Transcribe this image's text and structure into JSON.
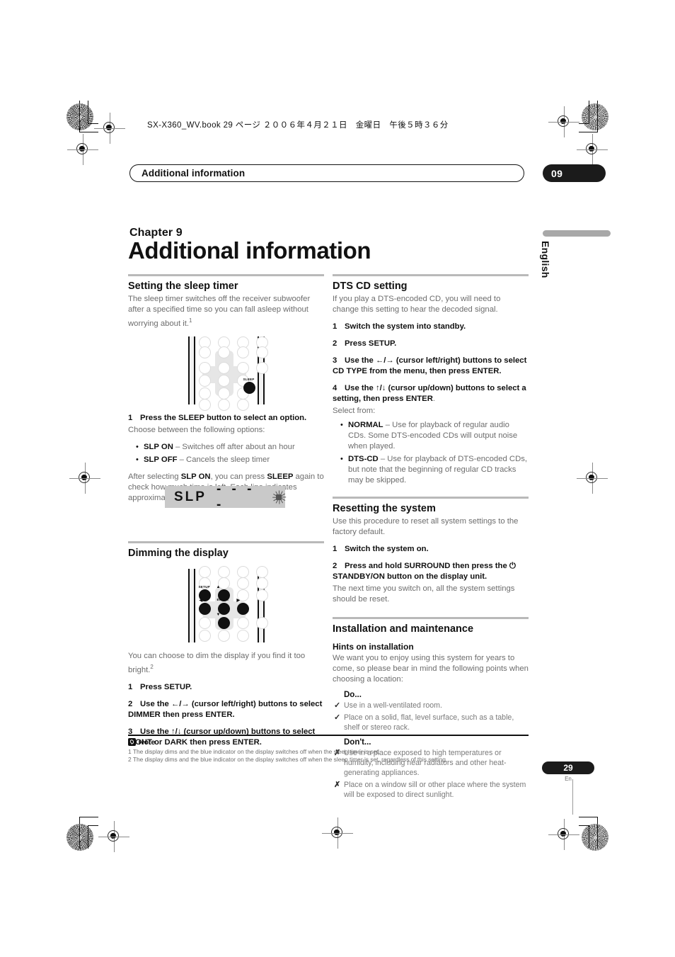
{
  "print_marks": {
    "book_header": "SX-X360_WV.book 29 ページ ２００６年４月２１日　金曜日　午後５時３６分"
  },
  "header": {
    "running_head": "Additional information",
    "chapter_badge": "09",
    "side_tab_label": "English"
  },
  "chapter": {
    "number_label": "Chapter 9",
    "title": "Additional information"
  },
  "left_column": {
    "sleep_timer": {
      "heading": "Setting the sleep timer",
      "intro": "The sleep timer switches off the receiver subwoofer after a specified time so you can fall asleep without worrying about it.",
      "intro_footnote": "1",
      "remote_sleep_label": "SLEEP",
      "step1": "Press the SLEEP button to select an option.",
      "step1_num": "1",
      "choose_line": "Choose between the following options:",
      "options": [
        {
          "term": "SLP ON",
          "desc": " – Switches off after about an hour"
        },
        {
          "term": "SLP OFF",
          "desc": " – Cancels the sleep timer"
        }
      ],
      "after_text_a": "After selecting ",
      "after_term_a": "SLP ON",
      "after_text_b": ", you can press ",
      "after_term_b": "SLEEP",
      "after_text_c": " again to check how much time is left. Each line indicates approximately 12 minutes (remaining):",
      "display_text": "SLP",
      "display_dashes": "- - - -",
      "display_icon": "sun-blink-icon"
    },
    "dimming": {
      "heading": "Dimming the display",
      "remote_setup_label": "SETUP",
      "remote_enter_label": "ENTER",
      "intro": "You can choose to dim the display if you find it too bright.",
      "intro_footnote": "2",
      "steps": [
        {
          "num": "1",
          "text": "Press SETUP."
        },
        {
          "num": "2",
          "text": "Use the ←/→ (cursor left/right) buttons to select DIMMER then press ENTER."
        },
        {
          "num": "3",
          "text": "Use the ↑/↓ (cursor up/down) buttons to select LIGHT or DARK then press ENTER."
        }
      ]
    }
  },
  "right_column": {
    "dts_cd": {
      "heading": "DTS CD setting",
      "intro": "If you play a DTS-encoded CD, you will need to change this setting to hear the decoded signal.",
      "steps": [
        {
          "num": "1",
          "text": "Switch the system into standby."
        },
        {
          "num": "2",
          "text": "Press SETUP."
        },
        {
          "num": "3",
          "text": "Use the ←/→ (cursor left/right) buttons to select CD TYPE from the menu, then press ENTER."
        },
        {
          "num": "4",
          "text": "Use the ↑/↓ (cursor up/down) buttons to select a setting, then press ENTER"
        }
      ],
      "select_from": "Select from:",
      "options": [
        {
          "term": "NORMAL",
          "desc": " – Use for playback of regular audio CDs. Some DTS-encoded CDs will output noise when played."
        },
        {
          "term": "DTS-CD",
          "desc": " – Use for playback of DTS-encoded CDs, but note that the beginning of regular CD tracks may be skipped."
        }
      ]
    },
    "resetting": {
      "heading": "Resetting the system",
      "intro": "Use this procedure to reset all system settings to the factory default.",
      "step1_num": "1",
      "step1": "Switch the system on.",
      "step2_num": "2",
      "step2": "Press and hold SURROUND then press the ⏻ STANDBY/ON button on the display unit.",
      "outro": "The next time you switch on, all the system settings should be reset."
    },
    "installation": {
      "heading": "Installation and maintenance",
      "subheading": "Hints on installation",
      "intro": "We want you to enjoy using this system for years to come, so please bear in mind the following points when choosing a location:",
      "do_label": "Do...",
      "do_items": [
        "Use in a well-ventilated room.",
        "Place on a solid, flat, level surface, such as a table, shelf or stereo rack."
      ],
      "dont_label": "Don't...",
      "dont_items": [
        "Use in a place exposed to high temperatures or humidity, including near radiators and other heat-generating appliances.",
        "Place on a window sill or other place where the system will be exposed to direct sunlight."
      ],
      "do_mark": "✓",
      "dont_mark": "✗"
    }
  },
  "note": {
    "label": "Note",
    "lines": [
      "1 The display dims and the blue indicator on the display switches off when the sleep timer is set.",
      "2 The display dims and the blue indicator on the display switches off when the sleep timer is set, regardless of this setting."
    ]
  },
  "footer": {
    "page_number": "29",
    "language": "En"
  }
}
